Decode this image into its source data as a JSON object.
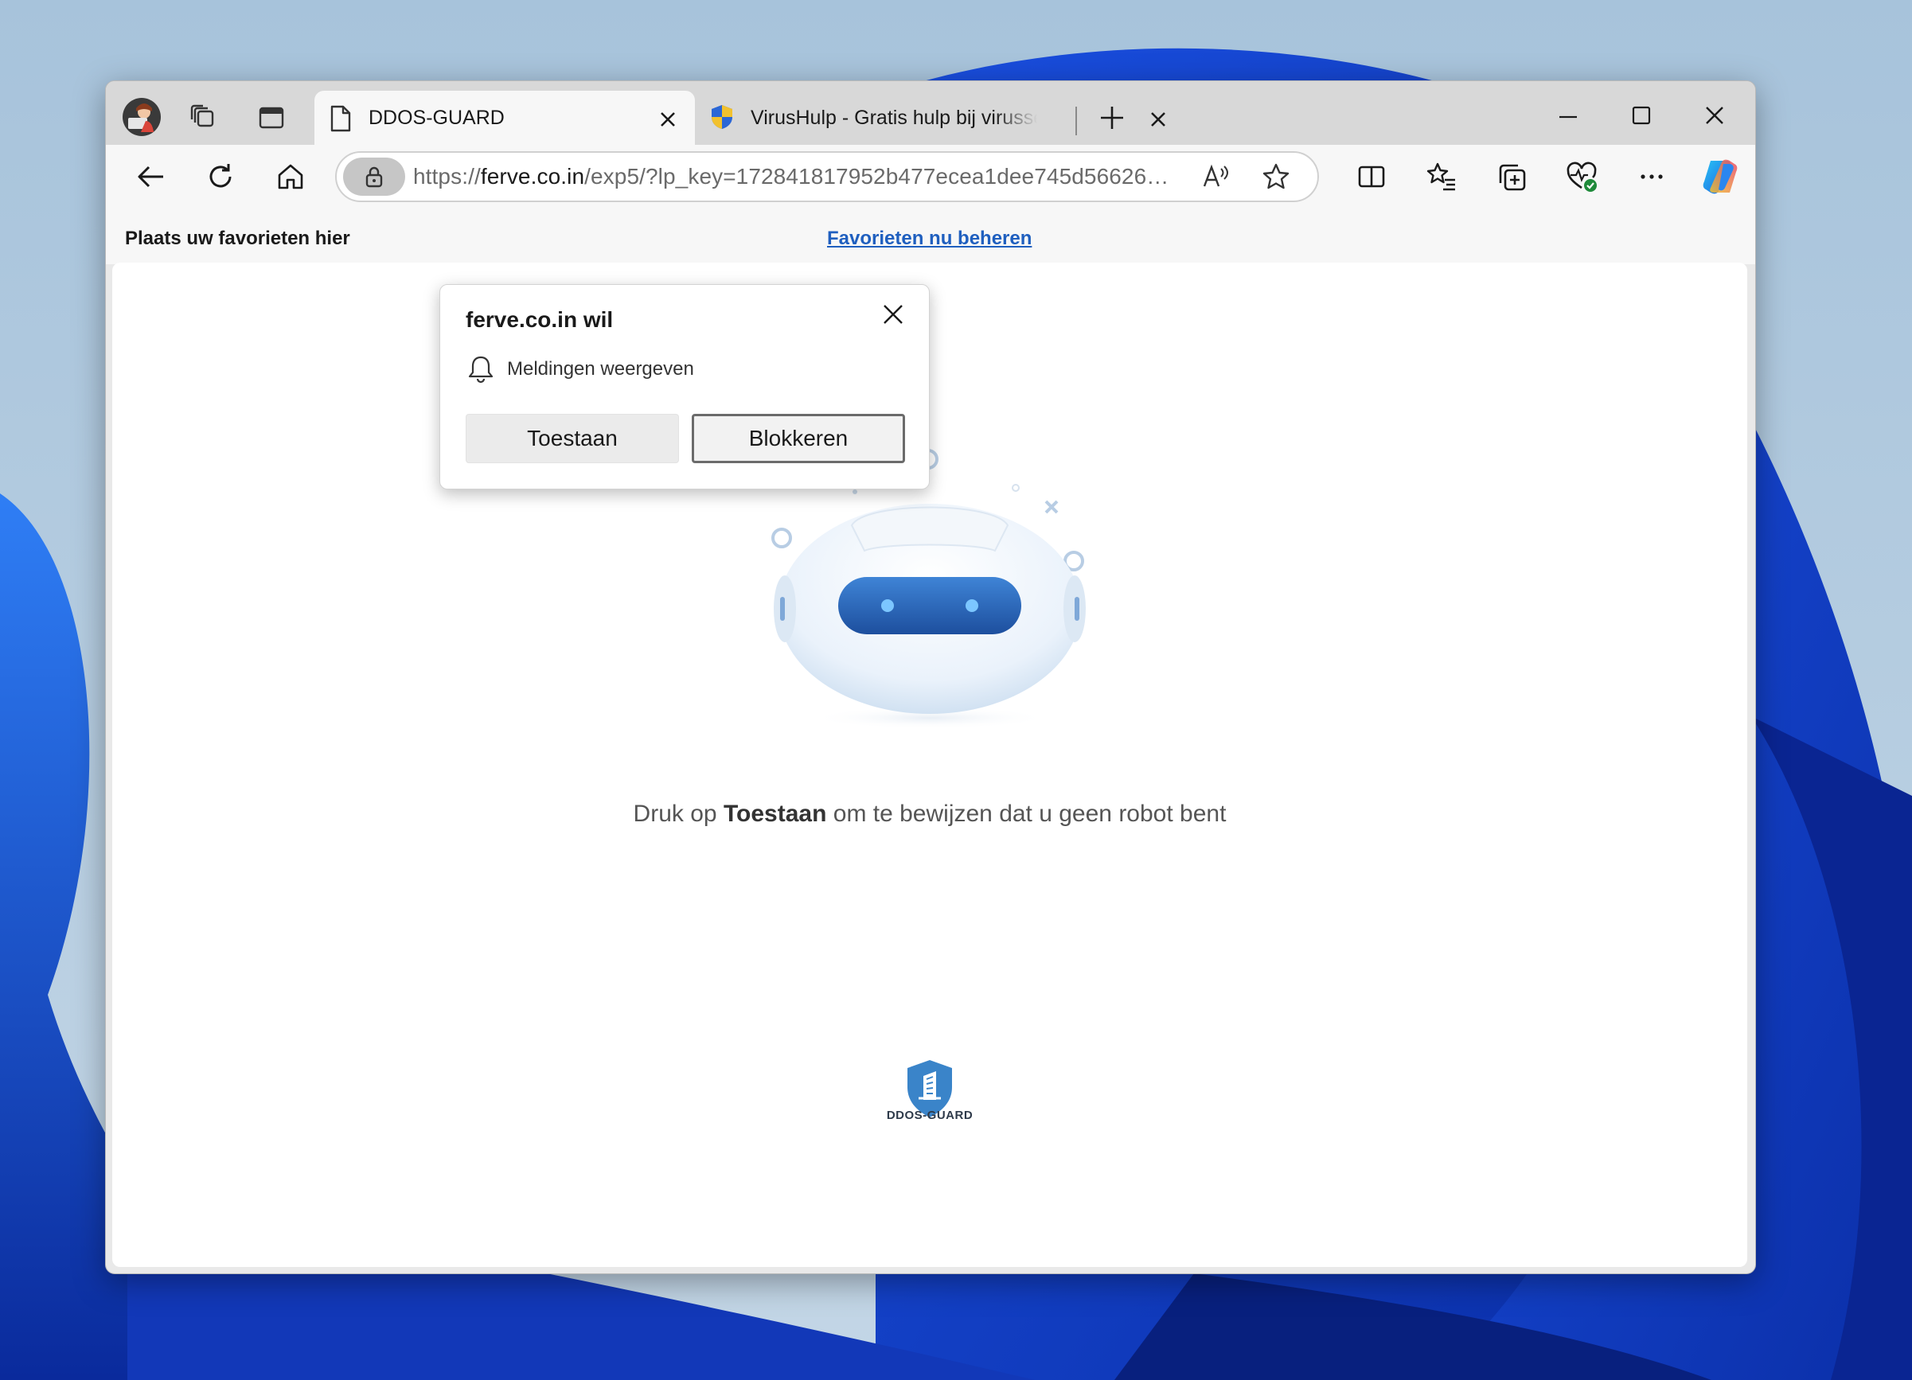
{
  "browser": {
    "tabs": [
      {
        "title": "DDOS-GUARD",
        "icon": "page-icon",
        "active": true
      },
      {
        "title": "VirusHulp - Gratis hulp bij virussen",
        "icon": "shield-favicon",
        "active": false
      }
    ],
    "address_bar": {
      "scheme": "https://",
      "host": "ferve.co.in",
      "path": "/exp5/?lp_key=172841817952b477ecea1dee745d56626b2..."
    },
    "favorites_bar": {
      "text": "Plaats uw favorieten hier",
      "link": "Favorieten nu beheren"
    },
    "accent_color": "#1f5fbf"
  },
  "permission_popup": {
    "title": "ferve.co.in wil",
    "permission": "Meldingen weergeven",
    "allow_label": "Toestaan",
    "block_label": "Blokkeren"
  },
  "page": {
    "instruction_prefix": "Druk op ",
    "instruction_bold": "Toestaan",
    "instruction_suffix": " om te bewijzen dat u geen robot bent",
    "brand_name": "DDOS-GUARD",
    "brand_color": "#3a84c9"
  }
}
